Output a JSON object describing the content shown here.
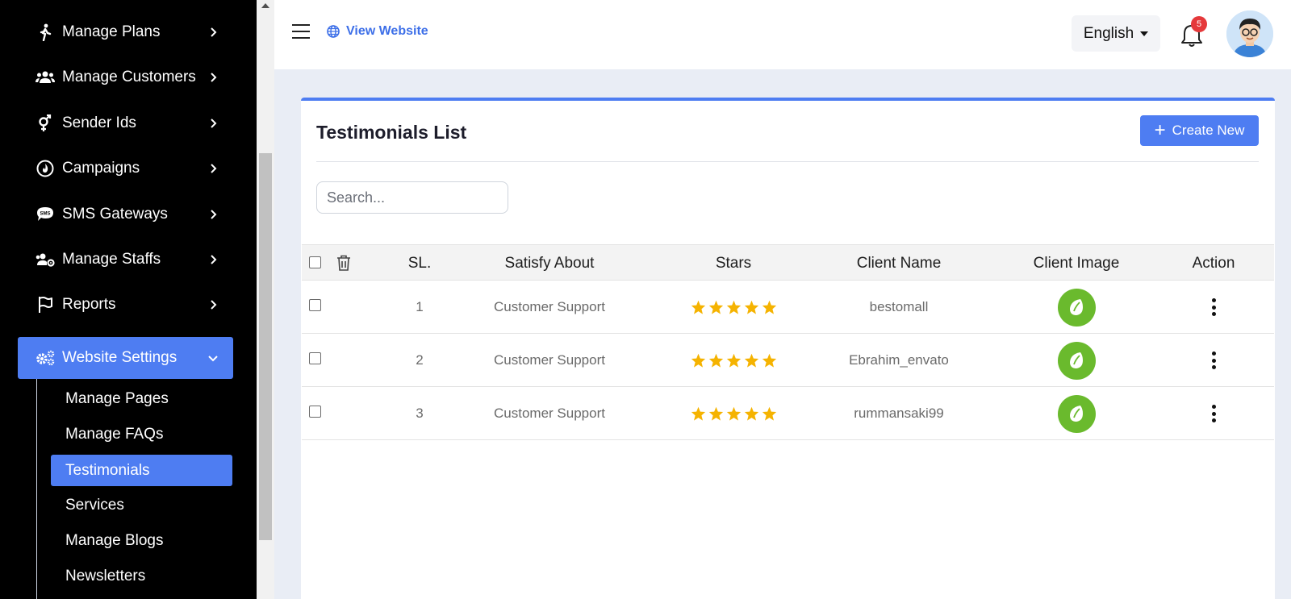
{
  "sidebar": {
    "items": [
      {
        "label": "Manage Plans",
        "icon": "walking-icon"
      },
      {
        "label": "Manage Customers",
        "icon": "users-icon"
      },
      {
        "label": "Sender Ids",
        "icon": "gender-icon"
      },
      {
        "label": "Campaigns",
        "icon": "fire-icon"
      },
      {
        "label": "SMS Gateways",
        "icon": "sms-icon"
      },
      {
        "label": "Manage Staffs",
        "icon": "users-cog-icon"
      },
      {
        "label": "Reports",
        "icon": "flag-icon"
      },
      {
        "label": "Website Settings",
        "icon": "cogs-icon"
      }
    ],
    "subitems": [
      "Manage Pages",
      "Manage FAQs",
      "Testimonials",
      "Services",
      "Manage Blogs",
      "Newsletters"
    ]
  },
  "header": {
    "view_website": "View Website",
    "language": "English",
    "notification_count": "5"
  },
  "card": {
    "title": "Testimonials List",
    "create_label": "Create New",
    "search_placeholder": "Search..."
  },
  "table": {
    "headers": {
      "sl": "SL.",
      "satisfy": "Satisfy About",
      "stars": "Stars",
      "client_name": "Client Name",
      "client_image": "Client Image",
      "action": "Action"
    },
    "rows": [
      {
        "sl": "1",
        "satisfy": "Customer Support",
        "stars": 5,
        "client_name": "bestomall"
      },
      {
        "sl": "2",
        "satisfy": "Customer Support",
        "stars": 5,
        "client_name": "Ebrahim_envato"
      },
      {
        "sl": "3",
        "satisfy": "Customer Support",
        "stars": 5,
        "client_name": "rummansaki99"
      }
    ]
  },
  "colors": {
    "accent": "#4e7df2",
    "star": "#f5b301",
    "client_image": "#6aba2d",
    "badge": "#e5393b"
  }
}
